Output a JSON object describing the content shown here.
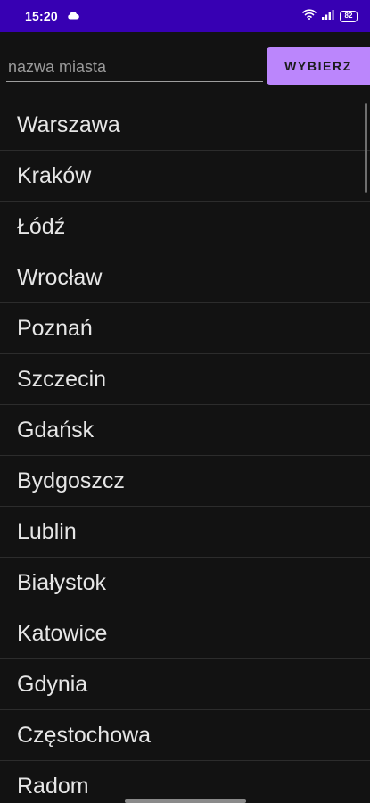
{
  "status_bar": {
    "time": "15:20",
    "battery_level": "82",
    "background_color": "#3700B3",
    "icons": [
      "cloud-icon",
      "wifi-icon",
      "signal-icon",
      "battery-icon"
    ]
  },
  "search": {
    "placeholder": "nazwa miasta",
    "value": ""
  },
  "choose_button": {
    "label": "WYBIERZ",
    "color": "#BB86FC"
  },
  "cities": [
    "Warszawa",
    "Kraków",
    "Łódź",
    "Wrocław",
    "Poznań",
    "Szczecin",
    "Gdańsk",
    "Bydgoszcz",
    "Lublin",
    "Białystok",
    "Katowice",
    "Gdynia",
    "Częstochowa",
    "Radom"
  ],
  "theme": {
    "background": "#121212",
    "text": "#e6e6e6",
    "divider": "#2c2c2c"
  }
}
